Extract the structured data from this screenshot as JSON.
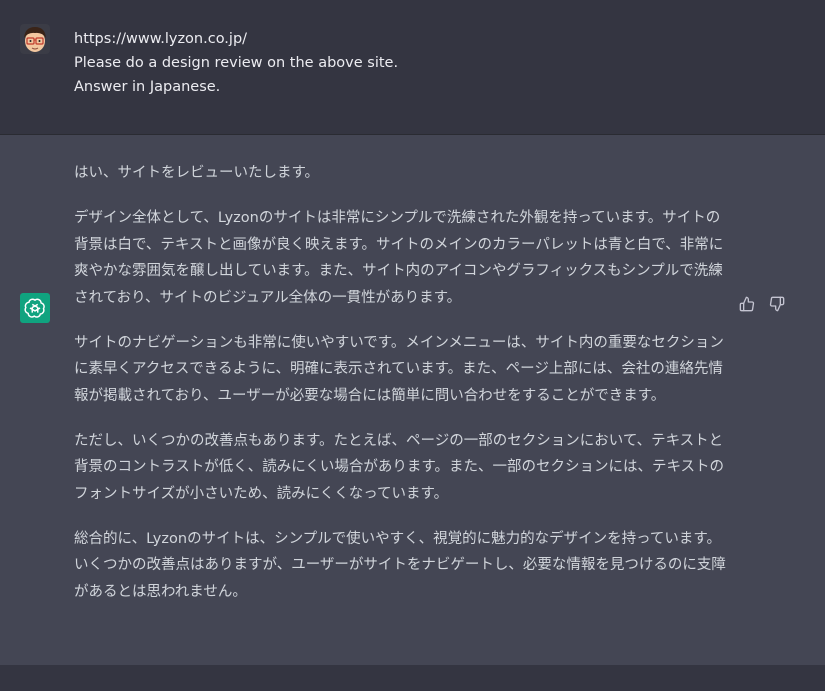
{
  "user": {
    "lines": [
      "https://www.lyzon.co.jp/",
      "Please do a design review on the above site.",
      "Answer in Japanese."
    ]
  },
  "assistant": {
    "paragraphs": [
      "はい、サイトをレビューいたします。",
      "デザイン全体として、Lyzonのサイトは非常にシンプルで洗練された外観を持っています。サイトの背景は白で、テキストと画像が良く映えます。サイトのメインのカラーパレットは青と白で、非常に爽やかな雰囲気を醸し出しています。また、サイト内のアイコンやグラフィックスもシンプルで洗練されており、サイトのビジュアル全体の一貫性があります。",
      "サイトのナビゲーションも非常に使いやすいです。メインメニューは、サイト内の重要なセクションに素早くアクセスできるように、明確に表示されています。また、ページ上部には、会社の連絡先情報が掲載されており、ユーザーが必要な場合には簡単に問い合わせをすることができます。",
      "ただし、いくつかの改善点もあります。たとえば、ページの一部のセクションにおいて、テキストと背景のコントラストが低く、読みにくい場合があります。また、一部のセクションには、テキストのフォントサイズが小さいため、読みにくくなっています。",
      "総合的に、Lyzonのサイトは、シンプルで使いやすく、視覚的に魅力的なデザインを持っています。いくつかの改善点はありますが、ユーザーがサイトをナビゲートし、必要な情報を見つけるのに支障があるとは思われません。"
    ]
  },
  "icons": {
    "user_avatar": "cartoon-face-avatar",
    "assistant_avatar": "openai-logo-icon",
    "like": "thumbs-up-icon",
    "dislike": "thumbs-down-icon"
  },
  "colors": {
    "user_bg": "#343541",
    "assistant_bg": "#444654",
    "assistant_avatar_bg": "#10a37f",
    "text": "#d1d5db"
  }
}
